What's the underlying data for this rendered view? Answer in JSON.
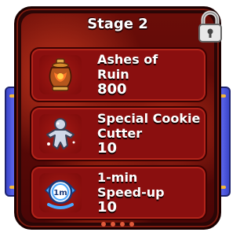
{
  "panel": {
    "title": "Stage 2",
    "rewards": [
      {
        "name_line1": "Ashes of",
        "name_line2": "Ruin",
        "amount": "800",
        "icon": "ashes-urn-icon"
      },
      {
        "name_line1": "Special Cookie",
        "name_line2": "Cutter",
        "amount": "10",
        "icon": "cookie-cutter-icon"
      },
      {
        "name_line1": "1-min",
        "name_line2": "Speed-up",
        "amount": "10",
        "icon": "speed-up-clock-icon"
      }
    ],
    "speedup_badge": "1m"
  },
  "colors": {
    "frame_bg": "#6a0d08",
    "card_bg": "#8a0f0f",
    "side_tab": "#4a54d8",
    "text": "#ffffff"
  }
}
